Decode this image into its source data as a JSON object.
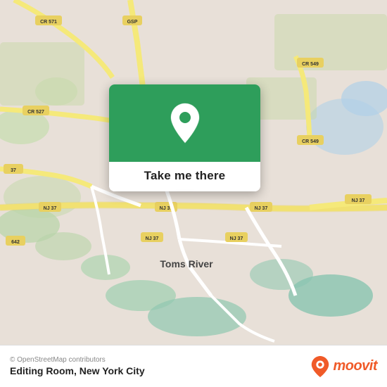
{
  "map": {
    "background_color": "#e8ead0",
    "attribution": "© OpenStreetMap contributors",
    "location": "Toms River"
  },
  "popup": {
    "button_label": "Take me there",
    "pin_color": "#ffffff"
  },
  "bottom_bar": {
    "place_name": "Editing Room, New York City",
    "moovit_text": "moovit"
  },
  "colors": {
    "green": "#2e9e5b",
    "orange": "#f05a28",
    "road_yellow": "#f5e97a",
    "road_white": "#ffffff",
    "land": "#e8e0d8",
    "water": "#c0d8e8",
    "park": "#c8ddb0"
  }
}
